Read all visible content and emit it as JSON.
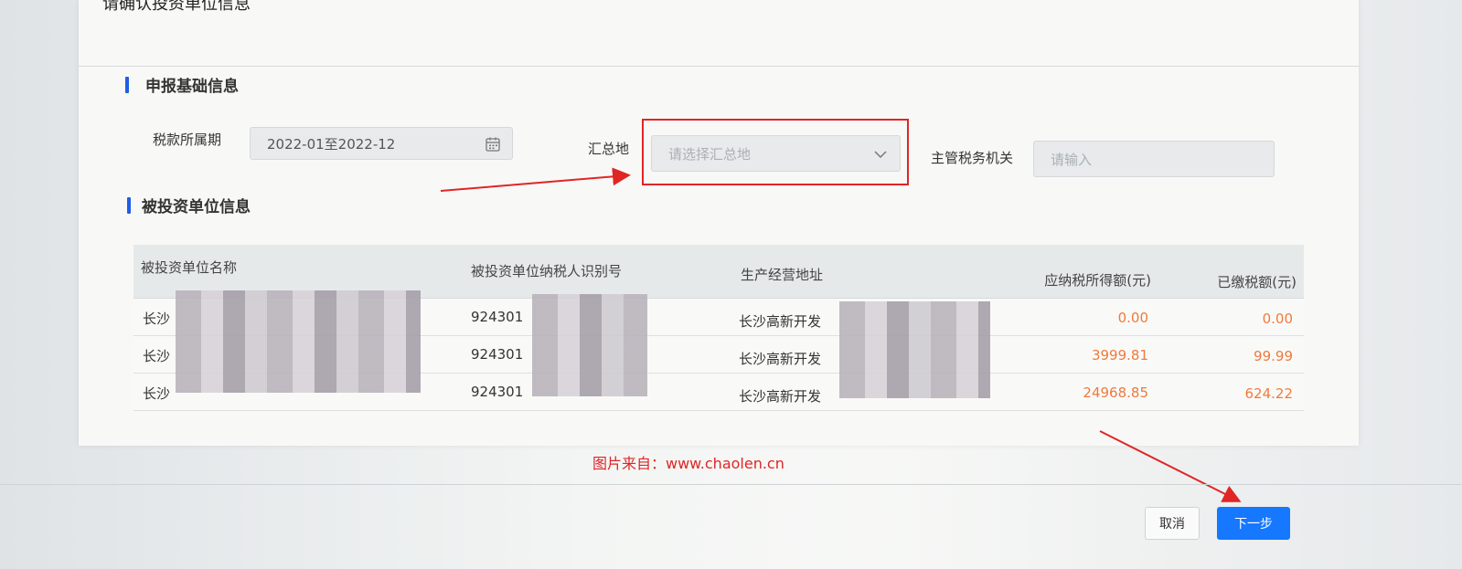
{
  "dialog": {
    "title": "请确认投资单位信息"
  },
  "basic_section": {
    "title": "申报基础信息",
    "period_label": "税款所属期",
    "period_value": "2022-01至2022-12",
    "summary_label": "汇总地",
    "summary_placeholder": "请选择汇总地",
    "authority_label": "主管税务机关",
    "authority_placeholder": "请输入"
  },
  "invested_section": {
    "title": "被投资单位信息",
    "columns": [
      "被投资单位名称",
      "被投资单位纳税人识别号",
      "生产经营地址",
      "应纳税所得额(元)",
      "已缴税额(元)"
    ],
    "rows": [
      {
        "name": "长沙",
        "tax_id": "924301",
        "address": "长沙高新开发",
        "taxable": "0.00",
        "paid": "0.00"
      },
      {
        "name": "长沙",
        "tax_id": "924301",
        "address": "长沙高新开发",
        "taxable": "3999.81",
        "paid": "99.99"
      },
      {
        "name": "长沙",
        "tax_id": "924301",
        "address": "长沙高新开发",
        "taxable": "24968.85",
        "paid": "624.22"
      }
    ]
  },
  "footer": {
    "cancel_label": "取消",
    "next_label": "下一步"
  },
  "watermark": "图片来自：www.chaolen.cn",
  "colors": {
    "primary": "#1677ff",
    "accent_bar": "#1e5ee6",
    "number": "#f07a3c",
    "annotation": "#e02525"
  }
}
